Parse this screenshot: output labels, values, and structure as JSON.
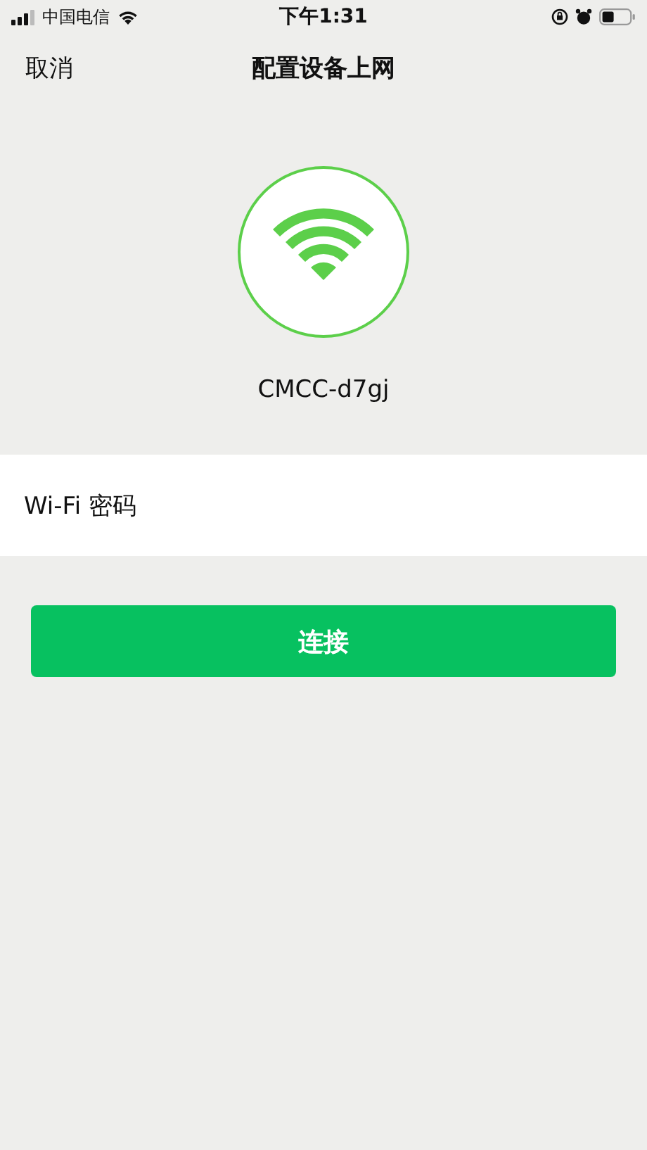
{
  "status_bar": {
    "carrier": "中国电信",
    "time": "下午1:31"
  },
  "nav": {
    "cancel": "取消",
    "title": "配置设备上网"
  },
  "network": {
    "ssid": "CMCC-d7gj"
  },
  "password_field": {
    "label": "Wi-Fi 密码"
  },
  "connect_button": {
    "label": "连接"
  }
}
